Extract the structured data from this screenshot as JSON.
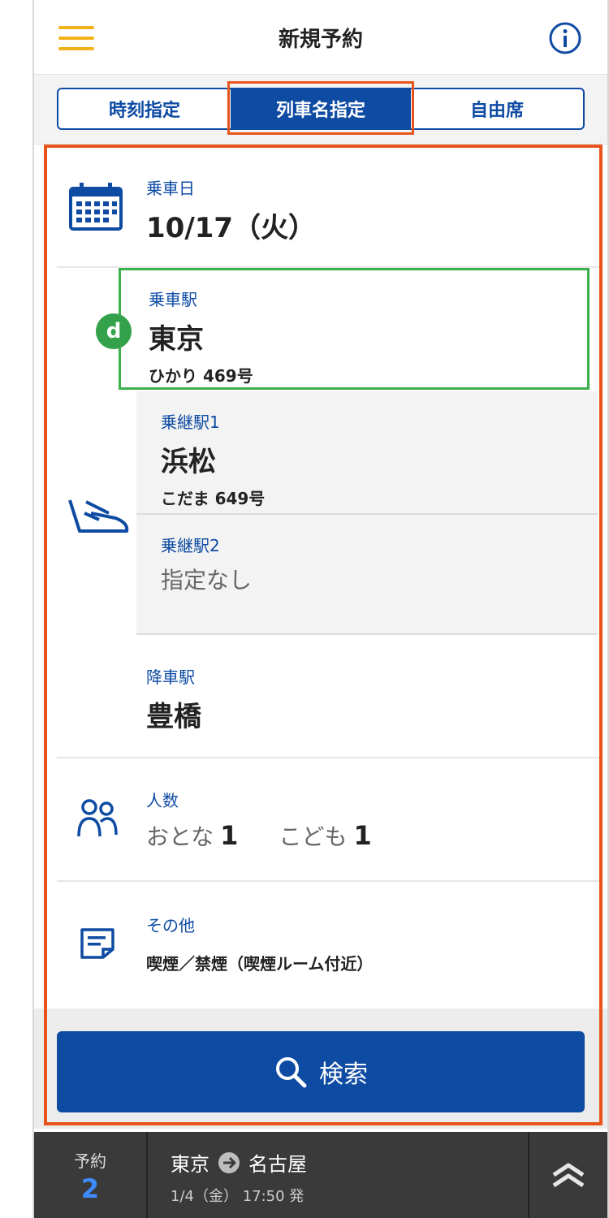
{
  "header": {
    "title": "新規予約",
    "menu_icon": "hamburger-menu-icon",
    "info_icon": "info-icon"
  },
  "tabs": [
    {
      "label": "時刻指定",
      "selected": false
    },
    {
      "label": "列車名指定",
      "selected": true
    },
    {
      "label": "自由席",
      "selected": false
    }
  ],
  "boarding_date": {
    "label": "乗車日",
    "value": "10/17（火）",
    "icon": "calendar-icon"
  },
  "departure": {
    "label": "乗車駅",
    "station": "東京",
    "train": "ひかり 469号",
    "badge": "d"
  },
  "transfer1": {
    "label": "乗継駅1",
    "station": "浜松",
    "train": "こだま 649号"
  },
  "transfer2": {
    "label": "乗継駅2",
    "value": "指定なし"
  },
  "arrival": {
    "label": "降車駅",
    "station": "豊橋"
  },
  "people": {
    "label": "人数",
    "adult_label": "おとな",
    "adult_count": "1",
    "child_label": "こども",
    "child_count": "1",
    "icon": "people-icon"
  },
  "other": {
    "label": "その他",
    "value": "喫煙／禁煙（喫煙ルーム付近）",
    "icon": "note-icon"
  },
  "search": {
    "label": "検索",
    "icon": "search-icon"
  },
  "footer": {
    "reservation_label": "予約",
    "reservation_count": "2",
    "from": "東京",
    "to": "名古屋",
    "time": "1/4（金）  17:50 発",
    "expand_icon": "double-chevron-up-icon"
  },
  "colors": {
    "primary": "#0e4ba3",
    "accent": "#e8541b",
    "highlight": "#3bb04d",
    "menu": "#f2b21b"
  }
}
